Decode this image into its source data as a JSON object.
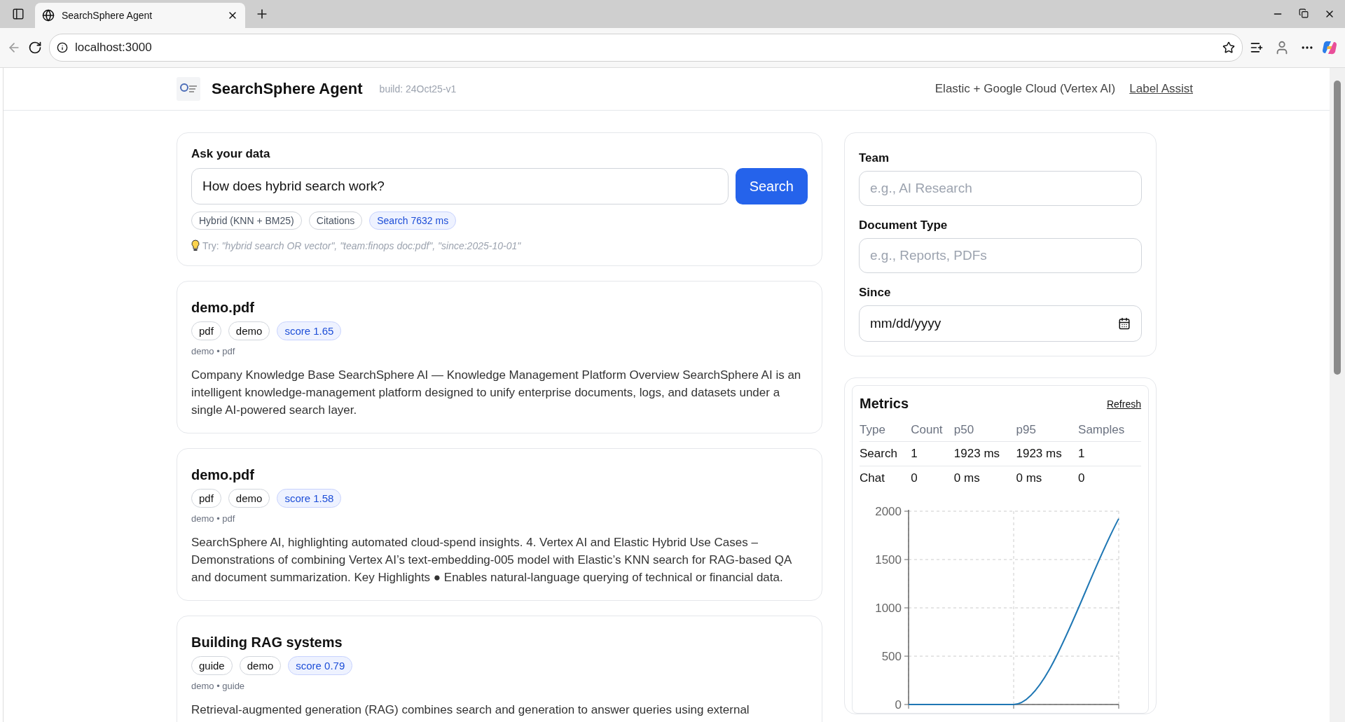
{
  "browser": {
    "tab_title": "SearchSphere Agent",
    "url": "localhost:3000"
  },
  "header": {
    "title": "SearchSphere Agent",
    "build": "build: 24Oct25-v1",
    "stack": "Elastic + Google Cloud (Vertex AI)",
    "link": "Label Assist"
  },
  "query": {
    "label": "Ask your data",
    "value": "How does hybrid search work?",
    "button": "Search",
    "chips": [
      {
        "text": "Hybrid (KNN + BM25)",
        "kind": "plain"
      },
      {
        "text": "Citations",
        "kind": "plain"
      },
      {
        "text": "Search 7632 ms",
        "kind": "accent"
      }
    ],
    "hint": "Try: *\"hybrid search OR vector\", \"team:finops doc:pdf\", \"since:2025-10-01\"*"
  },
  "results": [
    {
      "title": "demo.pdf",
      "tags": [
        {
          "text": "pdf",
          "kind": "plain"
        },
        {
          "text": "demo",
          "kind": "plain"
        },
        {
          "text": "score 1.65",
          "kind": "accent"
        }
      ],
      "meta": "demo • pdf",
      "snippet": "Company Knowledge Base SearchSphere AI — Knowledge Management Platform Overview SearchSphere AI is an intelligent knowledge-management platform designed to unify enterprise documents, logs, and datasets under a single AI-powered search layer."
    },
    {
      "title": "demo.pdf",
      "tags": [
        {
          "text": "pdf",
          "kind": "plain"
        },
        {
          "text": "demo",
          "kind": "plain"
        },
        {
          "text": "score 1.58",
          "kind": "accent"
        }
      ],
      "meta": "demo • pdf",
      "snippet": "SearchSphere AI, highlighting automated cloud-spend insights. 4. Vertex AI and Elastic Hybrid Use Cases – Demonstrations of combining Vertex AI’s text-embedding-005 model with Elastic’s KNN search for RAG-based QA and document summarization. Key Highlights ● Enables natural-language querying of technical or financial data."
    },
    {
      "title": "Building RAG systems",
      "tags": [
        {
          "text": "guide",
          "kind": "plain"
        },
        {
          "text": "demo",
          "kind": "plain"
        },
        {
          "text": "score 0.79",
          "kind": "accent"
        }
      ],
      "meta": "demo • guide",
      "snippet": "Retrieval-augmented generation (RAG) combines search and generation to answer queries using external"
    }
  ],
  "filters": [
    {
      "label": "Team",
      "kind": "text",
      "placeholder": "e.g., AI Research"
    },
    {
      "label": "Document Type",
      "kind": "text",
      "placeholder": "e.g., Reports, PDFs"
    },
    {
      "label": "Since",
      "kind": "date",
      "value": "mm/dd/yyyy"
    }
  ],
  "metrics": {
    "title": "Metrics",
    "refresh": "Refresh",
    "columns": [
      "Type",
      "Count",
      "p50",
      "p95",
      "Samples"
    ],
    "rows": [
      [
        "Search",
        "1",
        "1923 ms",
        "1923 ms",
        "1"
      ],
      [
        "Chat",
        "0",
        "0 ms",
        "0 ms",
        "0"
      ]
    ],
    "chart_data": {
      "type": "line",
      "grid": true,
      "ylim": [
        0,
        2000
      ],
      "yticks": [
        0,
        500,
        1000,
        1500,
        2000
      ],
      "series": [
        {
          "color": "#1f77b4",
          "values": [
            0,
            0,
            1923
          ]
        }
      ]
    }
  }
}
